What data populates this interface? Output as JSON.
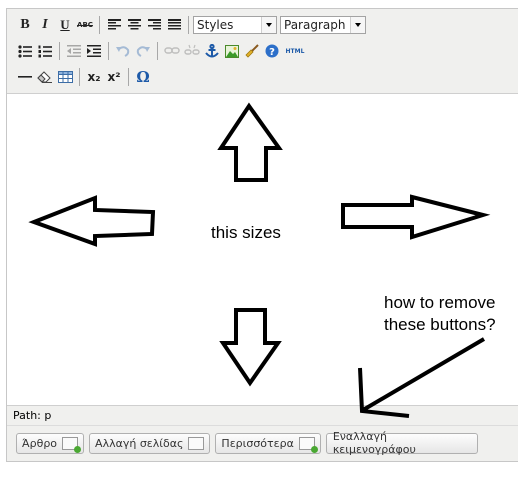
{
  "toolbar": {
    "styles_select": "Styles",
    "format_select": "Paragraph",
    "buttons": {
      "bold": "B",
      "italic": "I",
      "underline": "U",
      "strikethrough": "ABC",
      "html": "HTML",
      "subscript": "x₂",
      "superscript": "x²",
      "special_char": "Ω"
    }
  },
  "statusbar": {
    "path_label": "Path: p"
  },
  "editor_buttons": [
    "Άρθρο",
    "Αλλαγή σελίδας",
    "Περισσότερα",
    "Εναλλαγή κειμενογράφου"
  ],
  "annotations": {
    "center_label": "this sizes",
    "question_line1": "how to remove",
    "question_line2": "these buttons?"
  },
  "colors": {
    "toolbar_bg": "#f0f0ee",
    "anchor_icon": "#1d5aa8",
    "help_icon": "#2c6fc9"
  }
}
